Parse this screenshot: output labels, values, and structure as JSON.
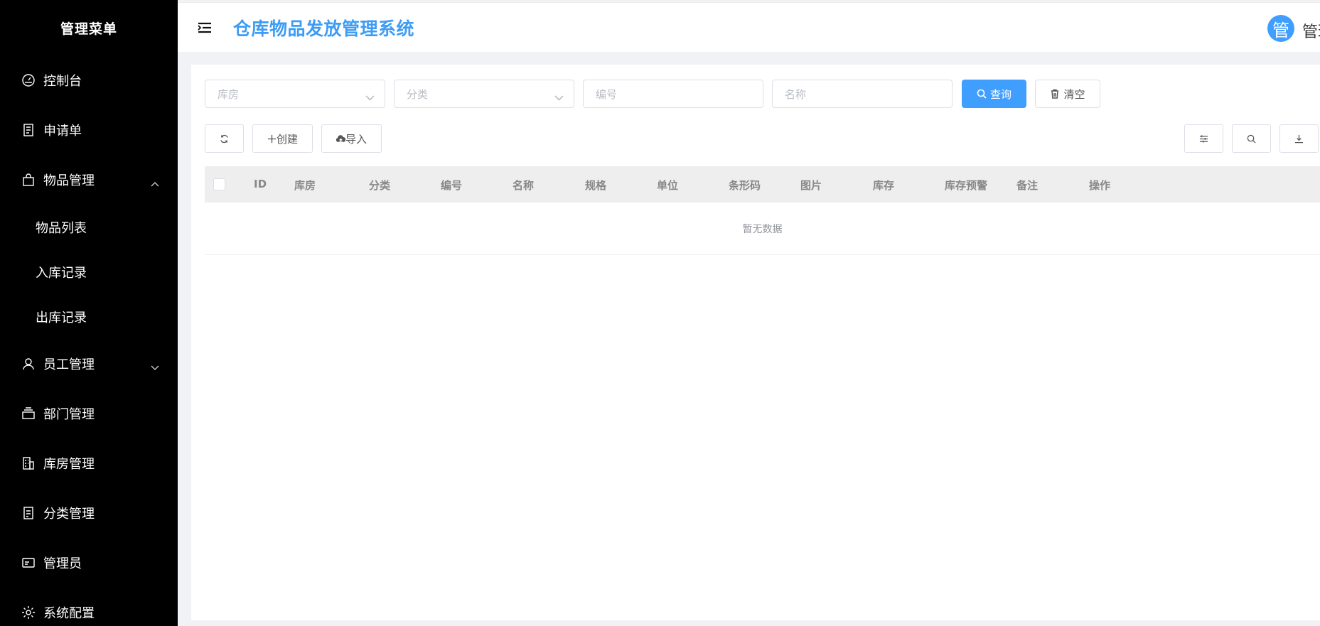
{
  "sidebar": {
    "title": "管理菜单",
    "items": [
      {
        "label": "控制台",
        "icon": "dashboard-icon"
      },
      {
        "label": "申请单",
        "icon": "document-icon"
      },
      {
        "label": "物品管理",
        "icon": "shopping-bag-icon",
        "expanded": true,
        "children": [
          {
            "label": "物品列表"
          },
          {
            "label": "入库记录"
          },
          {
            "label": "出库记录"
          }
        ]
      },
      {
        "label": "员工管理",
        "icon": "user-icon",
        "expanded": false
      },
      {
        "label": "部门管理",
        "icon": "stack-icon"
      },
      {
        "label": "库房管理",
        "icon": "building-icon"
      },
      {
        "label": "分类管理",
        "icon": "list-icon"
      },
      {
        "label": "管理员",
        "icon": "id-card-icon"
      },
      {
        "label": "系统配置",
        "icon": "gear-icon"
      }
    ]
  },
  "header": {
    "title": "仓库物品发放管理系统",
    "avatar_text": "管",
    "user_name": "管理员"
  },
  "filters": {
    "warehouse_placeholder": "库房",
    "category_placeholder": "分类",
    "code_placeholder": "编号",
    "name_placeholder": "名称",
    "search_label": "查询",
    "clear_label": "清空"
  },
  "toolbar": {
    "create_label": "创建",
    "import_label": "导入"
  },
  "table": {
    "columns": [
      "ID",
      "库房",
      "分类",
      "编号",
      "名称",
      "规格",
      "单位",
      "条形码",
      "图片",
      "库存",
      "库存预警",
      "备注",
      "操作"
    ],
    "empty_text": "暂无数据"
  },
  "colors": {
    "accent": "#409eff",
    "title": "#3d9cf5",
    "sidebar_bg": "#000000"
  }
}
